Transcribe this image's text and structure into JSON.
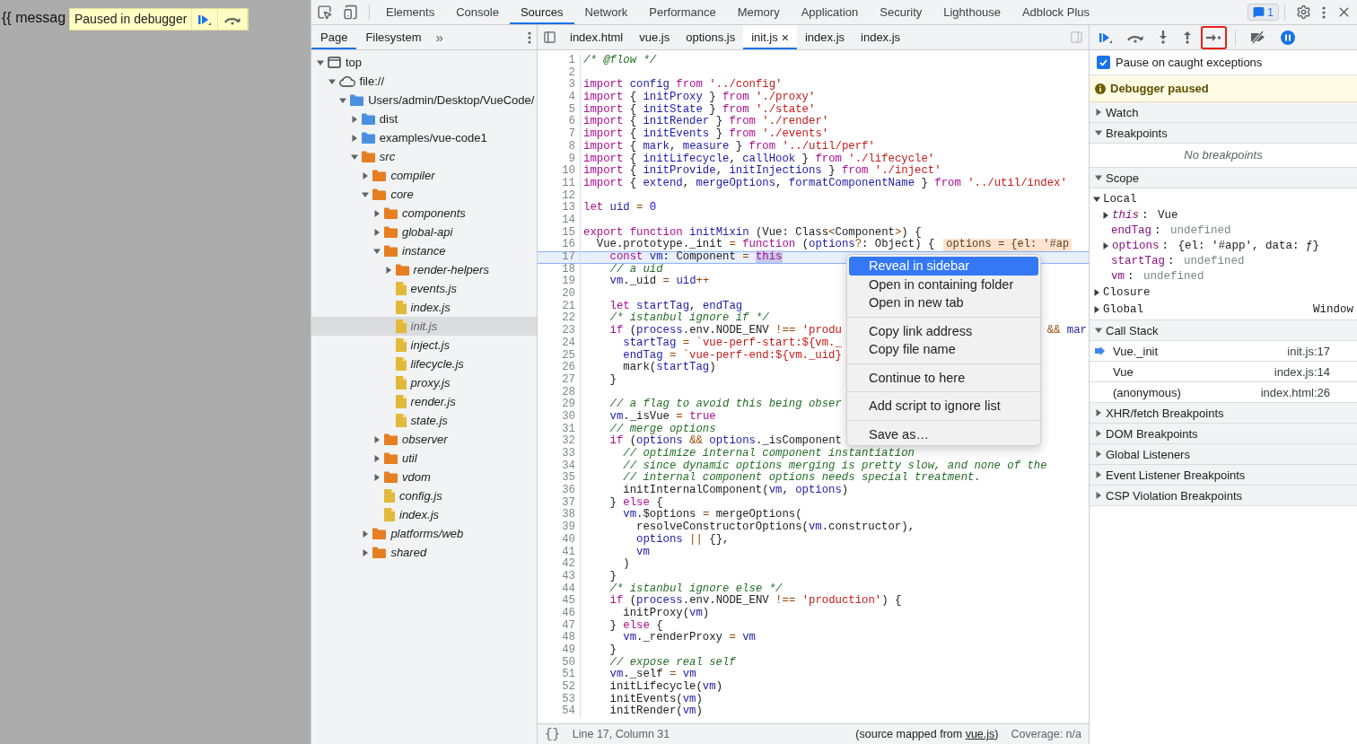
{
  "page": {
    "text": "{{ messag",
    "overlay": {
      "label": "Paused in debugger",
      "buttons": [
        {
          "kind": "resume"
        },
        {
          "kind": "step-over"
        }
      ]
    }
  },
  "main_tabs": [
    {
      "label": "Elements",
      "selected": false
    },
    {
      "label": "Console",
      "selected": false
    },
    {
      "label": "Sources",
      "selected": true
    },
    {
      "label": "Network",
      "selected": false
    },
    {
      "label": "Performance",
      "selected": false
    },
    {
      "label": "Memory",
      "selected": false
    },
    {
      "label": "Application",
      "selected": false
    },
    {
      "label": "Security",
      "selected": false
    },
    {
      "label": "Lighthouse",
      "selected": false
    },
    {
      "label": "Adblock Plus",
      "selected": false
    }
  ],
  "messages_badge": "1",
  "navigator": {
    "tabs": [
      {
        "label": "Page",
        "selected": true
      },
      {
        "label": "Filesystem",
        "selected": false
      }
    ],
    "more": "»",
    "tree": [
      {
        "label": "top",
        "kind": "frame",
        "expanded": true,
        "selected": false,
        "children": [
          {
            "label": "file://",
            "kind": "origin",
            "expanded": true,
            "selected": false,
            "children": [
              {
                "label": "Users/admin/Desktop/VueCode/",
                "kind": "folder",
                "expanded": true,
                "selected": false,
                "children": [
                  {
                    "label": "dist",
                    "kind": "folder",
                    "expanded": false,
                    "selected": false
                  },
                  {
                    "label": "examples/vue-code1",
                    "kind": "folder",
                    "expanded": false,
                    "selected": false
                  },
                  {
                    "label": "src",
                    "kind": "mapped-folder",
                    "expanded": true,
                    "selected": false,
                    "children": [
                      {
                        "label": "compiler",
                        "kind": "mapped-folder",
                        "expanded": false,
                        "selected": false
                      },
                      {
                        "label": "core",
                        "kind": "mapped-folder",
                        "expanded": true,
                        "selected": false,
                        "children": [
                          {
                            "label": "components",
                            "kind": "mapped-folder",
                            "expanded": false,
                            "selected": false
                          },
                          {
                            "label": "global-api",
                            "kind": "mapped-folder",
                            "expanded": false,
                            "selected": false
                          },
                          {
                            "label": "instance",
                            "kind": "mapped-folder",
                            "expanded": true,
                            "selected": false,
                            "children": [
                              {
                                "label": "render-helpers",
                                "kind": "mapped-folder",
                                "expanded": false,
                                "selected": false
                              },
                              {
                                "label": "events.js",
                                "kind": "file",
                                "selected": false
                              },
                              {
                                "label": "index.js",
                                "kind": "file",
                                "selected": false
                              },
                              {
                                "label": "init.js",
                                "kind": "file",
                                "selected": true
                              },
                              {
                                "label": "inject.js",
                                "kind": "file",
                                "selected": false
                              },
                              {
                                "label": "lifecycle.js",
                                "kind": "file",
                                "selected": false
                              },
                              {
                                "label": "proxy.js",
                                "kind": "file",
                                "selected": false
                              },
                              {
                                "label": "render.js",
                                "kind": "file",
                                "selected": false
                              },
                              {
                                "label": "state.js",
                                "kind": "file",
                                "selected": false
                              }
                            ]
                          },
                          {
                            "label": "observer",
                            "kind": "mapped-folder",
                            "expanded": false,
                            "selected": false
                          },
                          {
                            "label": "util",
                            "kind": "mapped-folder",
                            "expanded": false,
                            "selected": false
                          },
                          {
                            "label": "vdom",
                            "kind": "mapped-folder",
                            "expanded": false,
                            "selected": false
                          },
                          {
                            "label": "config.js",
                            "kind": "file",
                            "selected": false
                          },
                          {
                            "label": "index.js",
                            "kind": "file",
                            "selected": false
                          }
                        ]
                      },
                      {
                        "label": "platforms/web",
                        "kind": "mapped-folder",
                        "expanded": false,
                        "selected": false
                      },
                      {
                        "label": "shared",
                        "kind": "mapped-folder",
                        "expanded": false,
                        "selected": false
                      }
                    ]
                  }
                ]
              }
            ]
          }
        ]
      }
    ]
  },
  "editor": {
    "tabs": [
      {
        "label": "index.html",
        "selected": false
      },
      {
        "label": "vue.js",
        "selected": false
      },
      {
        "label": "options.js",
        "selected": false
      },
      {
        "label": "init.js",
        "selected": true,
        "close": "×"
      },
      {
        "label": "index.js",
        "selected": false
      },
      {
        "label": "index.js",
        "selected": false
      }
    ],
    "lines": [
      {
        "n": "1",
        "text": "/* @flow */",
        "paused": false
      },
      {
        "n": "2",
        "paused": false
      },
      {
        "n": "3",
        "text": "import config from '../config'",
        "paused": false
      },
      {
        "n": "4",
        "text": "import { initProxy } from './proxy'",
        "paused": false
      },
      {
        "n": "5",
        "text": "import { initState } from './state'",
        "paused": false
      },
      {
        "n": "6",
        "text": "import { initRender } from './render'",
        "paused": false
      },
      {
        "n": "7",
        "text": "import { initEvents } from './events'",
        "paused": false
      },
      {
        "n": "8",
        "text": "import { mark, measure } from '../util/perf'",
        "paused": false
      },
      {
        "n": "9",
        "text": "import { initLifecycle, callHook } from './lifecycle'",
        "paused": false
      },
      {
        "n": "10",
        "text": "import { initProvide, initInjections } from './inject'",
        "paused": false
      },
      {
        "n": "11",
        "text": "import { extend, mergeOptions, formatComponentName } from '../util/index'",
        "paused": false
      },
      {
        "n": "12",
        "paused": false
      },
      {
        "n": "13",
        "text": "let uid = 0",
        "paused": false
      },
      {
        "n": "14",
        "paused": false
      },
      {
        "n": "15",
        "text": "export function initMixin (Vue: Class<Component>) {",
        "paused": false
      },
      {
        "n": "16",
        "text": "  Vue.prototype._init = function (options?: Object) {",
        "inline_value": "options = {el: '#ap",
        "paused": false
      },
      {
        "n": "17",
        "text": "    const vm: Component = ",
        "highlight": "this",
        "paused": true
      },
      {
        "n": "18",
        "text": "    // a uid",
        "paused": false
      },
      {
        "n": "19",
        "text": "    vm._uid = uid++",
        "paused": false
      },
      {
        "n": "20",
        "paused": false
      },
      {
        "n": "21",
        "text": "    let startTag, endTag",
        "paused": false
      },
      {
        "n": "22",
        "text": "    /* istanbul ignore if */",
        "paused": false
      },
      {
        "n": "23",
        "text": "    if (process.env.NODE_ENV !== 'produ",
        "tail": "&& mar",
        "paused": false
      },
      {
        "n": "24",
        "text": "      startTag = `vue-perf-start:${vm._",
        "paused": false
      },
      {
        "n": "25",
        "text": "      endTag = `vue-perf-end:${vm._uid}",
        "paused": false
      },
      {
        "n": "26",
        "text": "      mark(startTag)",
        "paused": false
      },
      {
        "n": "27",
        "text": "    }",
        "paused": false
      },
      {
        "n": "28",
        "paused": false
      },
      {
        "n": "29",
        "text": "    // a flag to avoid this being obser",
        "paused": false
      },
      {
        "n": "30",
        "text": "    vm._isVue = true",
        "paused": false
      },
      {
        "n": "31",
        "text": "    // merge options",
        "paused": false
      },
      {
        "n": "32",
        "text": "    if (options && options._isComponent",
        "paused": false
      },
      {
        "n": "33",
        "text": "      // optimize internal component instantiation",
        "paused": false
      },
      {
        "n": "34",
        "text": "      // since dynamic options merging is pretty slow, and none of the",
        "paused": false
      },
      {
        "n": "35",
        "text": "      // internal component options needs special treatment.",
        "paused": false
      },
      {
        "n": "36",
        "text": "      initInternalComponent(vm, options)",
        "paused": false
      },
      {
        "n": "37",
        "text": "    } else {",
        "paused": false
      },
      {
        "n": "38",
        "text": "      vm.$options = mergeOptions(",
        "paused": false
      },
      {
        "n": "39",
        "text": "        resolveConstructorOptions(vm.constructor),",
        "paused": false
      },
      {
        "n": "40",
        "text": "        options || {},",
        "paused": false
      },
      {
        "n": "41",
        "text": "        vm",
        "paused": false
      },
      {
        "n": "42",
        "text": "      )",
        "paused": false
      },
      {
        "n": "43",
        "text": "    }",
        "paused": false
      },
      {
        "n": "44",
        "text": "    /* istanbul ignore else */",
        "paused": false
      },
      {
        "n": "45",
        "text": "    if (process.env.NODE_ENV !== 'production') {",
        "paused": false
      },
      {
        "n": "46",
        "text": "      initProxy(vm)",
        "paused": false
      },
      {
        "n": "47",
        "text": "    } else {",
        "paused": false
      },
      {
        "n": "48",
        "text": "      vm._renderProxy = vm",
        "paused": false
      },
      {
        "n": "49",
        "text": "    }",
        "paused": false
      },
      {
        "n": "50",
        "text": "    // expose real self",
        "paused": false
      },
      {
        "n": "51",
        "text": "    vm._self = vm",
        "paused": false
      },
      {
        "n": "52",
        "text": "    initLifecycle(vm)",
        "paused": false
      },
      {
        "n": "53",
        "text": "    initEvents(vm)",
        "paused": false
      },
      {
        "n": "54",
        "text": "    initRender(vm)",
        "paused": false
      }
    ],
    "context_menu": [
      [
        {
          "label": "Reveal in sidebar",
          "selected": true
        },
        {
          "label": "Open in containing folder",
          "selected": false
        },
        {
          "label": "Open in new tab",
          "selected": false
        }
      ],
      [
        {
          "label": "Copy link address",
          "selected": false
        },
        {
          "label": "Copy file name",
          "selected": false
        }
      ],
      [
        {
          "label": "Continue to here",
          "selected": false
        }
      ],
      [
        {
          "label": "Add script to ignore list",
          "selected": false
        }
      ],
      [
        {
          "label": "Save as…",
          "selected": false
        }
      ]
    ],
    "status": {
      "pretty_print": "{}",
      "position": "Line 17, Column 31",
      "mapped_prefix": "(source mapped from ",
      "mapped_link": "vue.js",
      "mapped_suffix": ")",
      "coverage": "Coverage: n/a"
    }
  },
  "debugger": {
    "toolbar": [
      {
        "kind": "resume",
        "outlined": false
      },
      {
        "kind": "step-over",
        "outlined": false
      },
      {
        "kind": "step-into",
        "outlined": false
      },
      {
        "kind": "step-out",
        "outlined": false
      },
      {
        "kind": "step",
        "outlined": true
      },
      {
        "kind": "deactivate",
        "outlined": false
      },
      {
        "kind": "pause-exceptions",
        "outlined": false
      }
    ],
    "pause_on_caught": {
      "label": "Pause on caught exceptions",
      "checked": true
    },
    "banner": "Debugger paused",
    "sections": [
      {
        "title": "Watch",
        "expanded": false
      },
      {
        "title": "Breakpoints",
        "expanded": true,
        "kind": "message",
        "message": "No breakpoints"
      },
      {
        "title": "Scope",
        "expanded": true,
        "kind": "scope",
        "scopes": [
          {
            "name": "Local",
            "expanded": true,
            "vars": [
              {
                "name": "this",
                "sep": ":",
                "value": "Vue",
                "kind": "receiver",
                "expandable": true
              },
              {
                "name": "endTag",
                "sep": ":",
                "value": "undefined",
                "kind": "undefined",
                "expandable": false
              },
              {
                "name": "options",
                "sep": ":",
                "value": "{el: '#app', data: ƒ}",
                "kind": "object",
                "expandable": true
              },
              {
                "name": "startTag",
                "sep": ":",
                "value": "undefined",
                "kind": "undefined",
                "expandable": false
              },
              {
                "name": "vm",
                "sep": ":",
                "value": "undefined",
                "kind": "undefined",
                "expandable": false
              }
            ]
          },
          {
            "name": "Closure",
            "expanded": false
          },
          {
            "name": "Global",
            "expanded": false,
            "value": "Window"
          }
        ]
      },
      {
        "title": "Call Stack",
        "expanded": true,
        "kind": "frames",
        "frames": [
          {
            "name": "Vue._init",
            "location": "init.js:17",
            "selected": true
          },
          {
            "name": "Vue",
            "location": "index.js:14",
            "selected": false
          },
          {
            "name": "(anonymous)",
            "location": "index.html:26",
            "selected": false
          }
        ]
      },
      {
        "title": "XHR/fetch Breakpoints",
        "expanded": false
      },
      {
        "title": "DOM Breakpoints",
        "expanded": false
      },
      {
        "title": "Global Listeners",
        "expanded": false
      },
      {
        "title": "Event Listener Breakpoints",
        "expanded": false
      },
      {
        "title": "CSP Violation Breakpoints",
        "expanded": false
      }
    ]
  }
}
